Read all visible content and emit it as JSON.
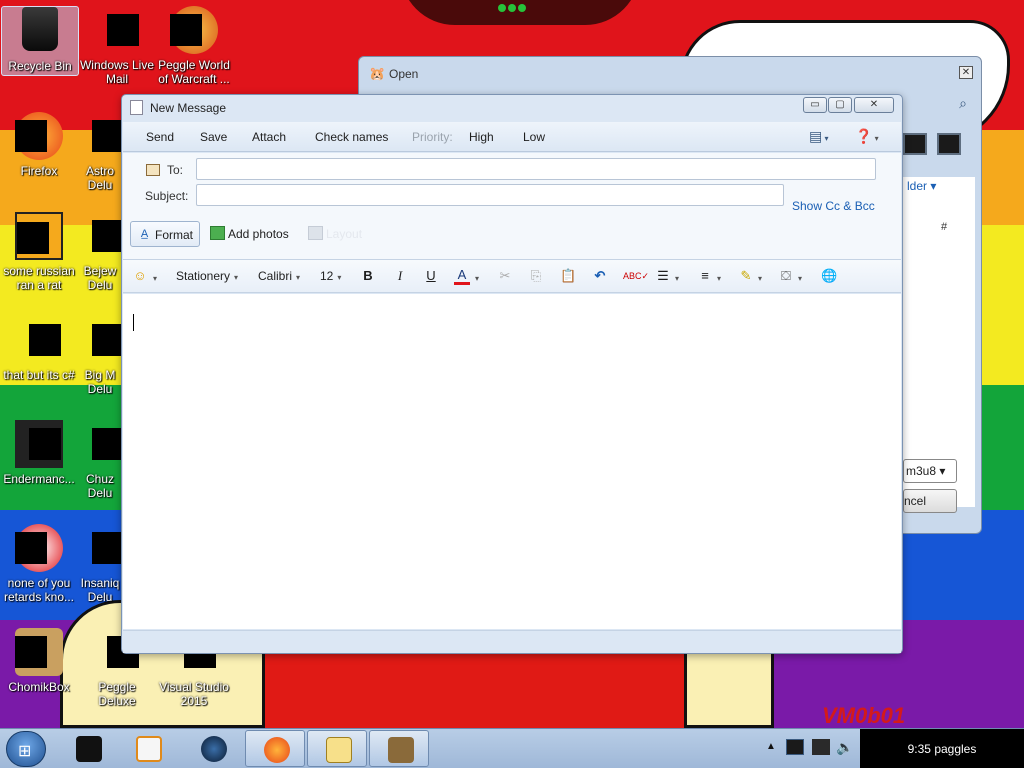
{
  "desktop": {
    "icons": [
      {
        "label": "Recycle Bin"
      },
      {
        "label": "Windows Live Mail"
      },
      {
        "label": "Peggle World of Warcraft ..."
      },
      {
        "label": "Firefox"
      },
      {
        "label": "Astro Delu"
      },
      {
        "label": "some russian ran a rat"
      },
      {
        "label": "Bejew Delu"
      },
      {
        "label": "that but its c#"
      },
      {
        "label": "Big M Delu"
      },
      {
        "label": "Endermanc..."
      },
      {
        "label": "Chuz Delu"
      },
      {
        "label": "none of you retards kno..."
      },
      {
        "label": "Insaniq Delu"
      },
      {
        "label": "ChomikBox"
      },
      {
        "label": "Peggle Deluxe"
      },
      {
        "label": "Visual Studio 2015"
      }
    ],
    "wallpaper_label": "VM0b01",
    "colors": {
      "red": "#e0141b",
      "orange": "#f5a91c",
      "yellow": "#f3ea20",
      "green": "#13a53a",
      "blue": "#1656d6",
      "purple": "#7a1aa8"
    }
  },
  "open_dialog": {
    "title": "Open",
    "folder_link": "lder",
    "hash": "#",
    "select_value": "m3u8",
    "cancel_label": "ncel"
  },
  "new_message": {
    "title": "New Message",
    "window_buttons": {
      "minimize": "▭",
      "maximize": "▢",
      "close": "✕"
    },
    "commands": {
      "send": "Send",
      "save": "Save",
      "attach": "Attach",
      "check_names": "Check names",
      "priority": "Priority:",
      "high": "High",
      "low": "Low"
    },
    "headers": {
      "to_label": "To:",
      "to_value": "",
      "subject_label": "Subject:",
      "subject_value": "",
      "show_cc_bcc": "Show Cc & Bcc"
    },
    "tabs": {
      "format": "Format",
      "add_photos": "Add photos",
      "layout": "Layout"
    },
    "formatting": {
      "stationery": "Stationery",
      "font": "Calibri",
      "size": "12",
      "bold": "B",
      "italic": "I",
      "underline": "U",
      "font_color": "A"
    },
    "body_text": ""
  },
  "taskbar": {
    "clock": "9:35 paggles",
    "buttons": [
      {
        "icon": "screen-icon"
      },
      {
        "icon": "media-player-icon"
      },
      {
        "icon": "globe-icon"
      },
      {
        "icon": "firefox-icon",
        "open": true
      },
      {
        "icon": "mail-icon",
        "open": true
      },
      {
        "icon": "hamster-icon",
        "open": true
      }
    ]
  }
}
